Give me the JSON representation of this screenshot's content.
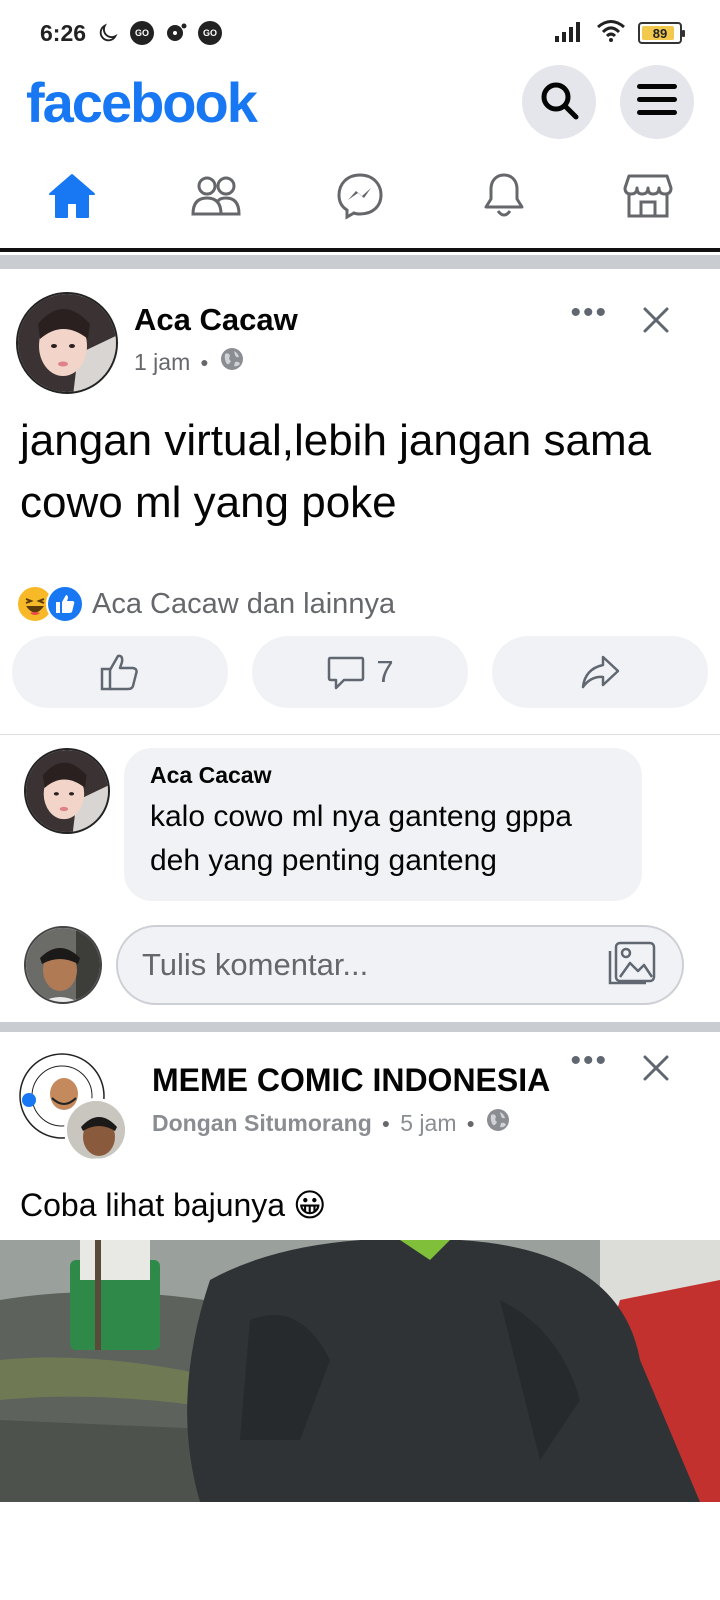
{
  "status_bar": {
    "time": "6:26",
    "battery": "89",
    "battery_level": 0.89,
    "icons": [
      "moon-icon",
      "go-badge-icon",
      "chat-notification-icon",
      "go-badge-icon",
      "signal-icon",
      "wifi-icon",
      "battery-icon"
    ]
  },
  "header": {
    "logo": "facebook",
    "brand_color": "#1877f2",
    "actions": [
      "search-icon",
      "menu-icon"
    ]
  },
  "nav": {
    "tabs": [
      {
        "icon": "home-icon",
        "active": true
      },
      {
        "icon": "friends-icon",
        "active": false
      },
      {
        "icon": "messenger-icon",
        "active": false
      },
      {
        "icon": "bell-icon",
        "active": false
      },
      {
        "icon": "marketplace-icon",
        "active": false
      }
    ]
  },
  "post1": {
    "author": "Aca Cacaw",
    "time": "1 jam",
    "audience_icon": "globe-icon",
    "text": "jangan virtual,lebih jangan sama cowo ml yang poke",
    "reactions_text": "Aca Cacaw dan lainnya",
    "reaction_icons": [
      "haha-icon",
      "like-icon"
    ],
    "comment_count": "7",
    "comment": {
      "author": "Aca Cacaw",
      "text": "kalo cowo ml nya ganteng gppa deh yang penting ganteng"
    },
    "comment_placeholder": "Tulis komentar..."
  },
  "post2": {
    "page": "MEME COMIC INDONESIA",
    "poster": "Dongan Situmorang",
    "time": "5 jam",
    "audience_icon": "globe-icon",
    "text": "Coba lihat bajunya",
    "emoji": "😀"
  }
}
